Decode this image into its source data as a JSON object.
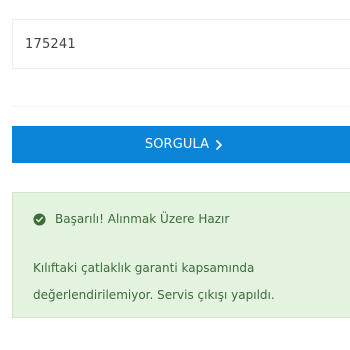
{
  "query_input": {
    "value": "175241"
  },
  "submit_button": {
    "label": "SORGULA",
    "icon": "chevron-right-icon"
  },
  "result_alert": {
    "status_icon": "check-circle-icon",
    "title": "Başarılı! Alınmak Üzere Hazır",
    "message": "Kılıftaki çatlaklık garanti kapsamında değerlendirilemiyor. Servis çıkışı yapıldı."
  },
  "colors": {
    "button_background": "#0a84d7",
    "alert_background": "#e4f2e0",
    "alert_text": "#3b6e3a"
  }
}
